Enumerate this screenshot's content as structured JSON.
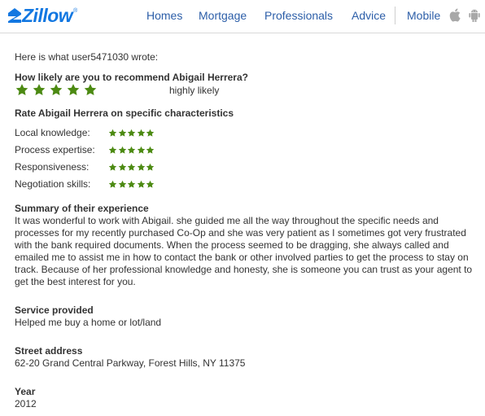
{
  "header": {
    "logo_text": "Zillow",
    "nav": [
      {
        "label": "Homes"
      },
      {
        "label": "Mortgage"
      },
      {
        "label": "Professionals"
      },
      {
        "label": "Advice"
      },
      {
        "label": "Mobile"
      }
    ],
    "icons": [
      "apple-icon",
      "android-icon"
    ]
  },
  "review": {
    "intro": "Here is what user5471030 wrote:",
    "recommend_question": "How likely are you to recommend Abigail Herrera?",
    "recommend_rating": 5,
    "recommend_text": "highly likely",
    "characteristics_title": "Rate Abigail Herrera on specific characteristics",
    "characteristics": [
      {
        "label": "Local knowledge:",
        "rating": 5
      },
      {
        "label": "Process expertise:",
        "rating": 5
      },
      {
        "label": "Responsiveness:",
        "rating": 5
      },
      {
        "label": "Negotiation skills:",
        "rating": 5
      }
    ],
    "summary_title": "Summary of their experience",
    "summary_text": "It was wonderful to work with Abigail. she guided me all the way throughout the specific needs and processes for my recently purchased Co-Op and she was very patient as I sometimes got very frustrated with the bank required documents. When the process seemed to be dragging, she always called and emailed me to assist me in how to contact the bank or other involved parties to get the process to stay on track. Because of her professional knowledge and honesty, she is someone you can trust as your agent to get the best interest for you.",
    "service_title": "Service provided",
    "service_text": "Helped me buy a home or lot/land",
    "address_title": "Street address",
    "address_text": "62-20 Grand Central Parkway, Forest Hills, NY 11375",
    "year_title": "Year",
    "year_text": "2012"
  },
  "colors": {
    "brand": "#1277e1",
    "nav": "#2c5ea8",
    "star": "#4c8a12"
  }
}
